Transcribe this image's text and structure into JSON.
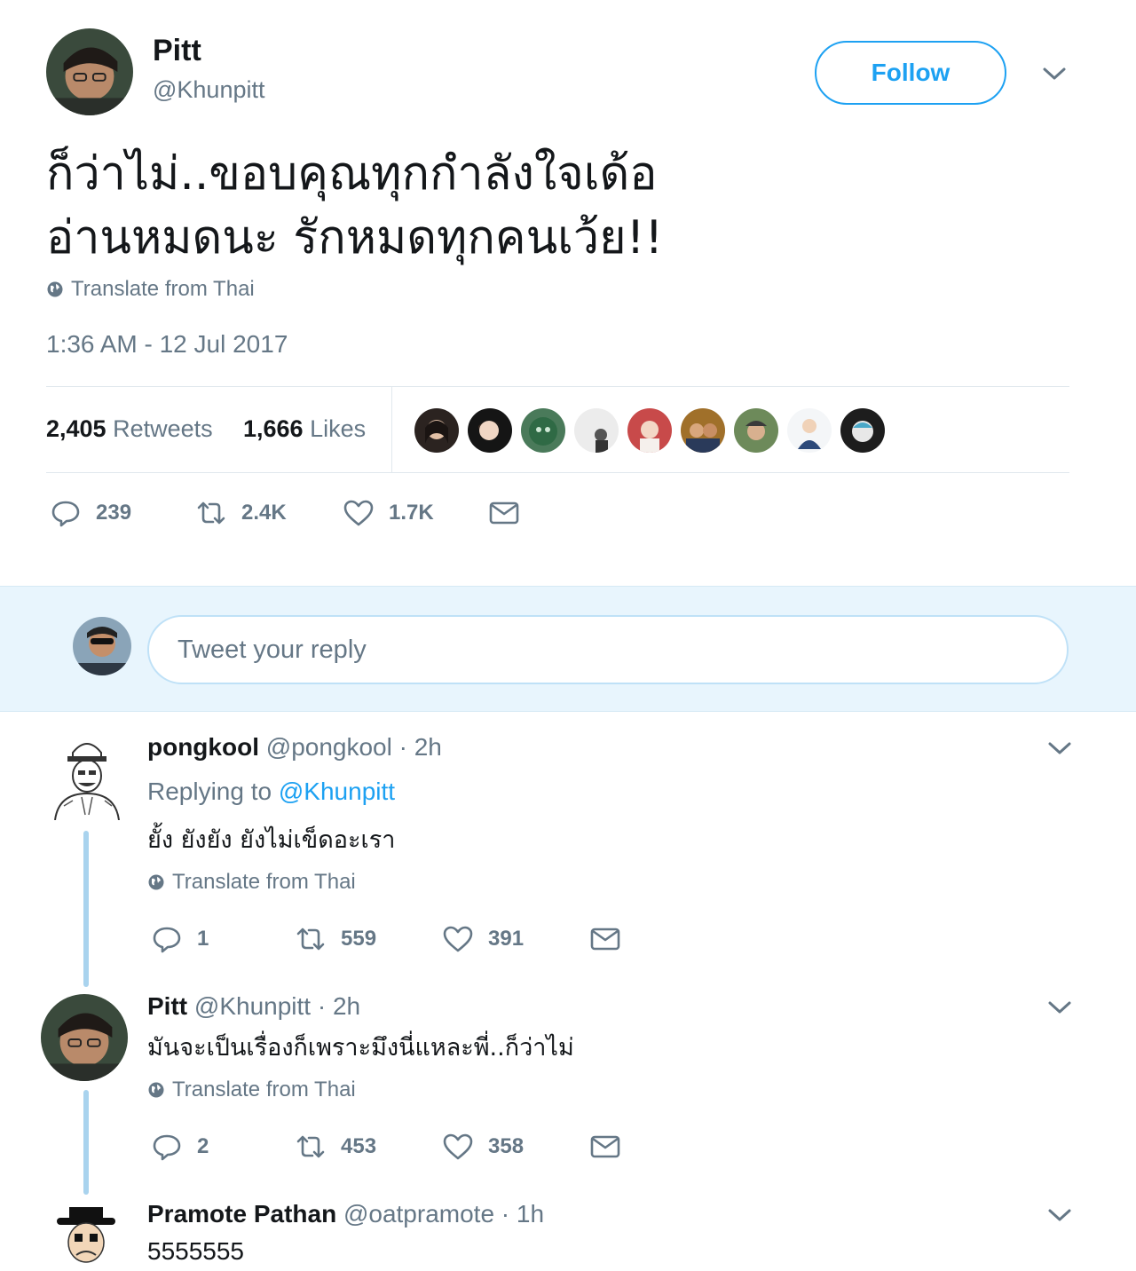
{
  "main_tweet": {
    "display_name": "Pitt",
    "handle": "@Khunpitt",
    "follow_label": "Follow",
    "text_line1": "ก็ว่าไม่..ขอบคุณทุกกำลังใจเด้อ",
    "text_line2": "อ่านหมดนะ รักหมดทุกคนเว้ย!!",
    "translate_label": "Translate from Thai",
    "timestamp": "1:36 AM - 12 Jul 2017",
    "retweets_count": "2,405",
    "retweets_label": "Retweets",
    "likes_count": "1,666",
    "likes_label": "Likes",
    "actions": {
      "replies": "239",
      "retweets": "2.4K",
      "likes": "1.7K"
    }
  },
  "reply_box": {
    "placeholder": "Tweet your reply"
  },
  "replies": [
    {
      "display_name": "pongkool",
      "handle_time": "@pongkool · 2h",
      "replying_prefix": "Replying to",
      "replying_to": "@Khunpitt",
      "text": "ยั้ง ยังยัง ยังไม่เข็ดอะเรา",
      "translate_label": "Translate from Thai",
      "actions": {
        "replies": "1",
        "retweets": "559",
        "likes": "391"
      }
    },
    {
      "display_name": "Pitt",
      "handle_time": "@Khunpitt · 2h",
      "text": "มันจะเป็นเรื่องก็เพราะมึงนี่แหละพี่..ก็ว่าไม่",
      "translate_label": "Translate from Thai",
      "actions": {
        "replies": "2",
        "retweets": "453",
        "likes": "358"
      }
    },
    {
      "display_name": "Pramote Pathan",
      "handle_time": "@oatpramote · 1h",
      "text": "5555555"
    }
  ],
  "colors": {
    "accent": "#1da1f2",
    "muted": "#657786",
    "text": "#14171a",
    "reply_bg": "#e8f5fd",
    "thread_line": "#a9d3ee"
  },
  "icons": [
    "globe-icon",
    "reply-icon",
    "retweet-icon",
    "like-icon",
    "dm-icon",
    "chevron-down-icon"
  ]
}
